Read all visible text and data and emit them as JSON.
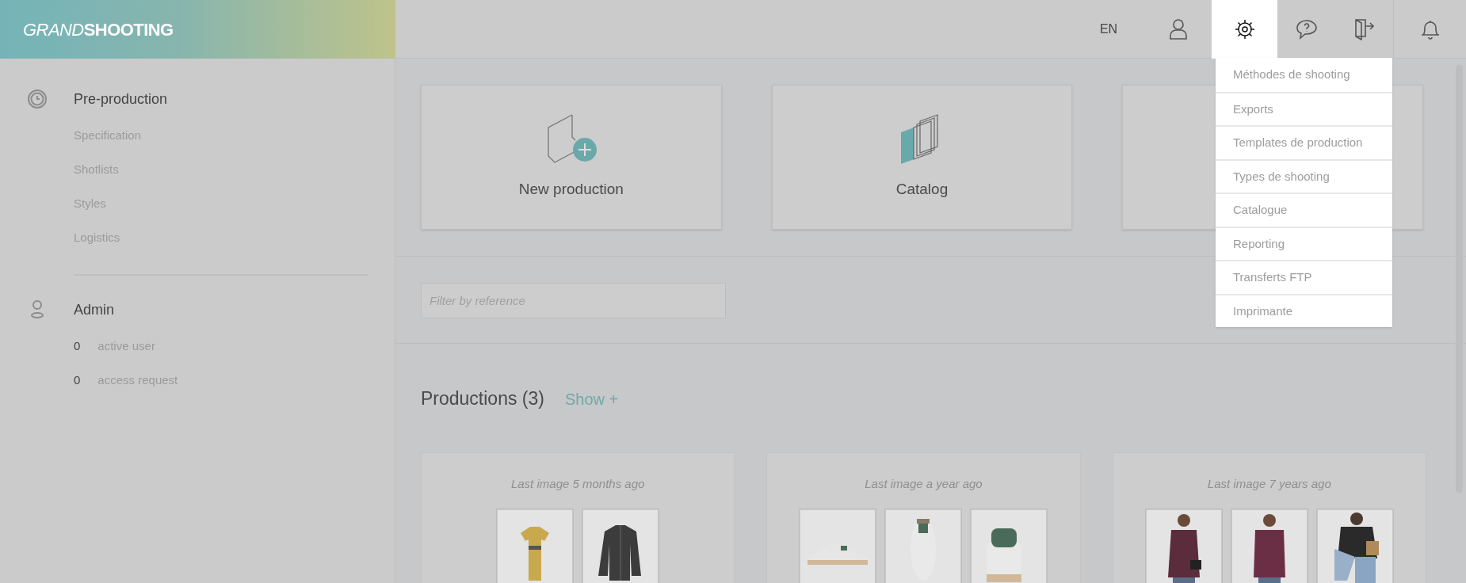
{
  "brand": {
    "light": "GRAND",
    "bold": "SHOOTING"
  },
  "topbar": [
    {
      "kind": "language",
      "label": "EN",
      "selected": false
    },
    {
      "kind": "user",
      "selected": false
    },
    {
      "kind": "settings",
      "selected": true
    },
    {
      "kind": "help",
      "selected": false
    },
    {
      "kind": "logout",
      "selected": false
    },
    {
      "kind": "notifications",
      "selected": false
    }
  ],
  "settings_menu": [
    "Méthodes de shooting",
    "Exports",
    "Templates de production",
    "Types de shooting",
    "Catalogue",
    "Reporting",
    "Transferts FTP",
    "Imprimante"
  ],
  "sidebar": [
    {
      "kind": "clock",
      "title": "Pre-production",
      "items": [
        {
          "label": "Specification"
        },
        {
          "label": "Shotlists"
        },
        {
          "label": "Styles"
        },
        {
          "label": "Logistics"
        }
      ]
    },
    {
      "kind": "person",
      "title": "Admin",
      "items": [
        {
          "count": "0",
          "label": "active user"
        },
        {
          "count": "0",
          "label": "access request"
        }
      ]
    }
  ],
  "actions": [
    {
      "kind": "new",
      "label": "New production"
    },
    {
      "kind": "catalog",
      "label": "Catalog"
    },
    {
      "kind": "hidden"
    }
  ],
  "filter": {
    "placeholder": "Filter by reference"
  },
  "productions": {
    "title": "Productions (3)",
    "toggle": "Show +",
    "cards": [
      {
        "caption": "Last image 5 months ago"
      },
      {
        "caption": "Last image a year ago"
      },
      {
        "caption": "Last image 7 years ago"
      }
    ]
  }
}
